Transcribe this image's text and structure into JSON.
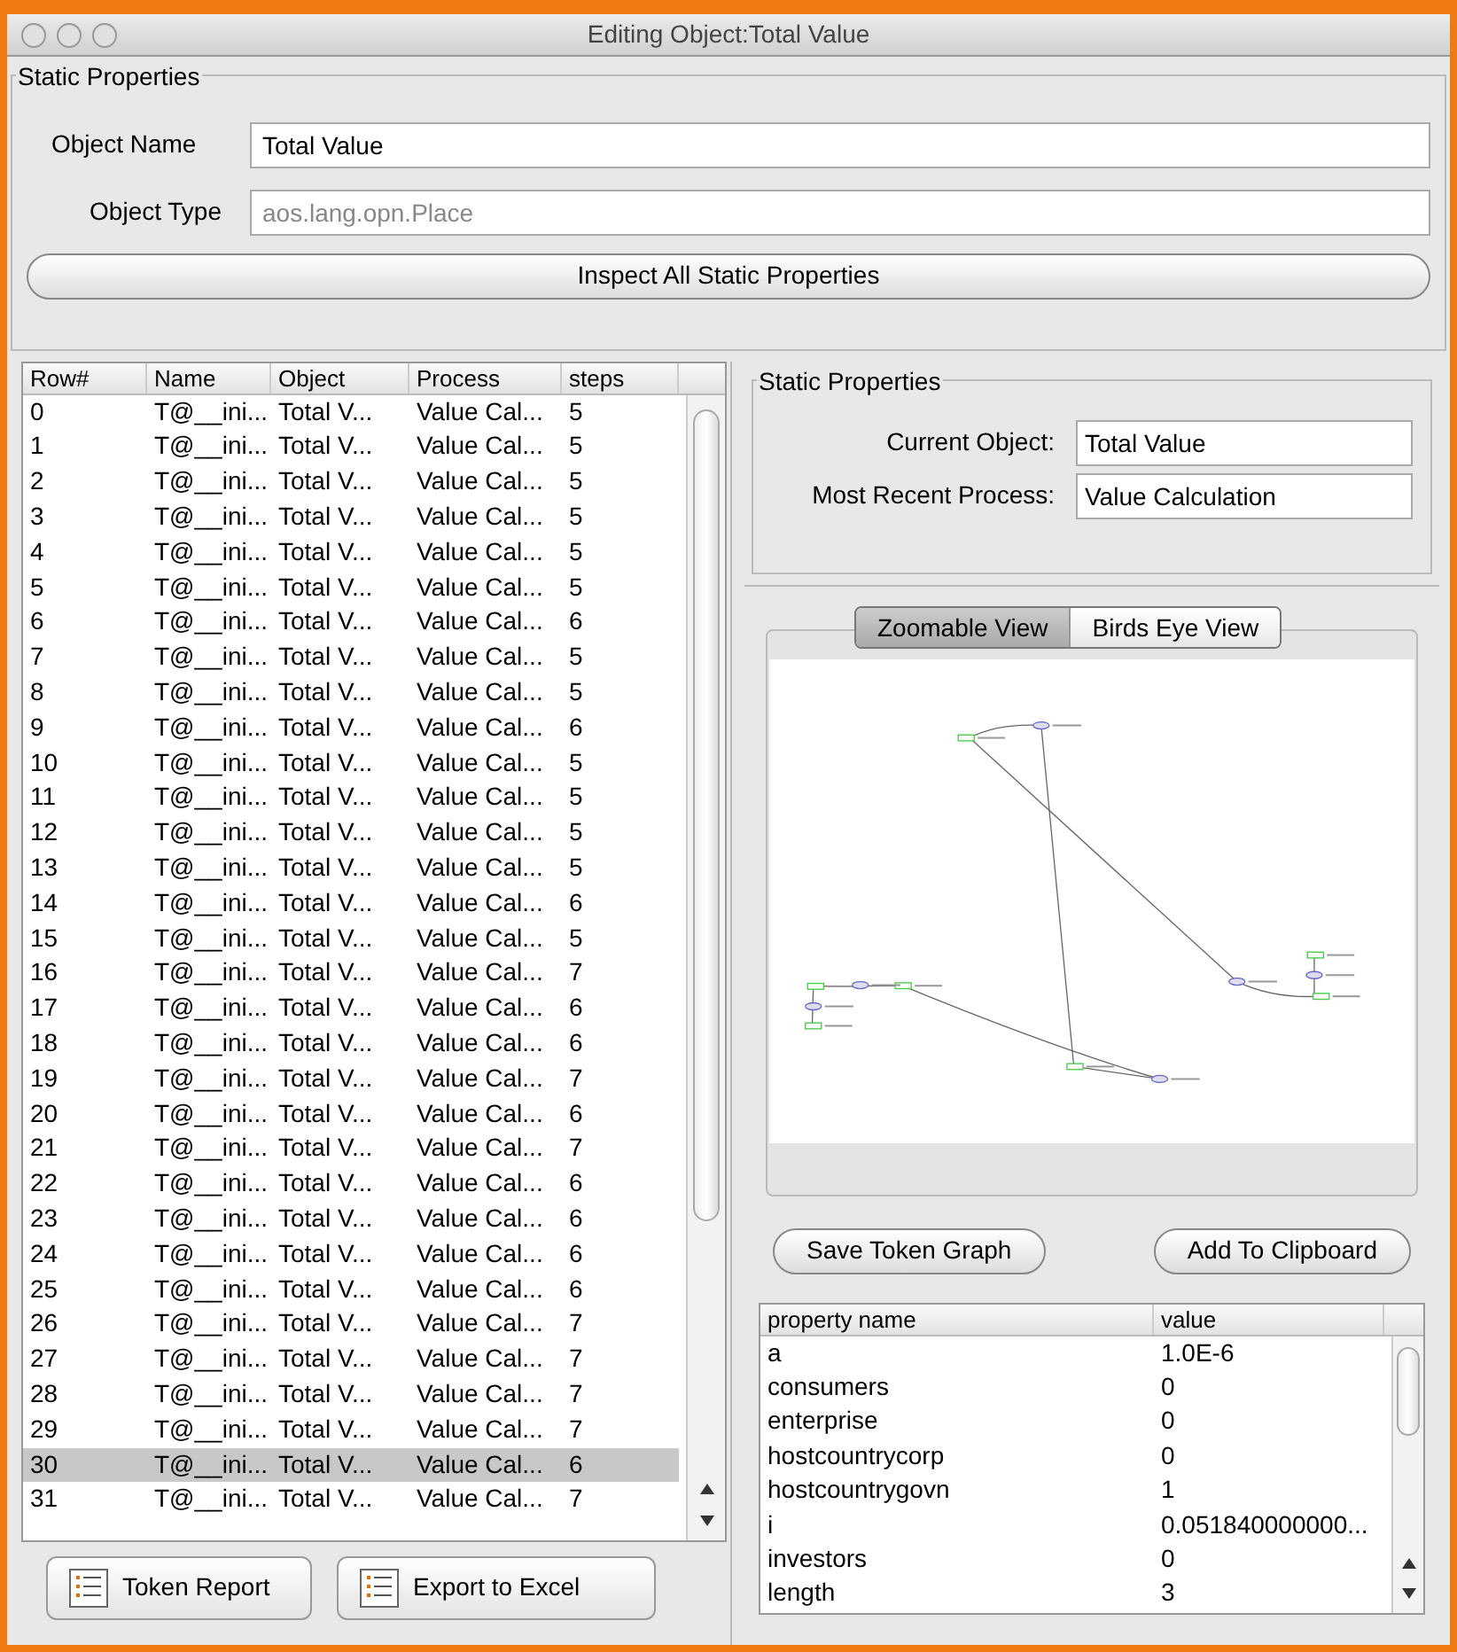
{
  "window": {
    "title": "Editing Object:Total Value"
  },
  "static_properties": {
    "title": "Static Properties",
    "object_name": {
      "label": "Object Name",
      "value": "Total Value"
    },
    "object_type": {
      "label": "Object Type",
      "value": "aos.lang.opn.Place",
      "disabled": true
    },
    "inspect_button": "Inspect All Static Properties"
  },
  "token_table": {
    "columns": [
      "Row#",
      "Name",
      "Object",
      "Process",
      "steps"
    ],
    "rows": [
      {
        "cells": [
          "0",
          "T@__ini...",
          "Total V...",
          "Value Cal...",
          "5"
        ],
        "selected": false
      },
      {
        "cells": [
          "1",
          "T@__ini...",
          "Total V...",
          "Value Cal...",
          "5"
        ],
        "selected": false
      },
      {
        "cells": [
          "2",
          "T@__ini...",
          "Total V...",
          "Value Cal...",
          "5"
        ],
        "selected": false
      },
      {
        "cells": [
          "3",
          "T@__ini...",
          "Total V...",
          "Value Cal...",
          "5"
        ],
        "selected": false
      },
      {
        "cells": [
          "4",
          "T@__ini...",
          "Total V...",
          "Value Cal...",
          "5"
        ],
        "selected": false
      },
      {
        "cells": [
          "5",
          "T@__ini...",
          "Total V...",
          "Value Cal...",
          "5"
        ],
        "selected": false
      },
      {
        "cells": [
          "6",
          "T@__ini...",
          "Total V...",
          "Value Cal...",
          "6"
        ],
        "selected": false
      },
      {
        "cells": [
          "7",
          "T@__ini...",
          "Total V...",
          "Value Cal...",
          "5"
        ],
        "selected": false
      },
      {
        "cells": [
          "8",
          "T@__ini...",
          "Total V...",
          "Value Cal...",
          "5"
        ],
        "selected": false
      },
      {
        "cells": [
          "9",
          "T@__ini...",
          "Total V...",
          "Value Cal...",
          "6"
        ],
        "selected": false
      },
      {
        "cells": [
          "10",
          "T@__ini...",
          "Total V...",
          "Value Cal...",
          "5"
        ],
        "selected": false
      },
      {
        "cells": [
          "11",
          "T@__ini...",
          "Total V...",
          "Value Cal...",
          "5"
        ],
        "selected": false
      },
      {
        "cells": [
          "12",
          "T@__ini...",
          "Total V...",
          "Value Cal...",
          "5"
        ],
        "selected": false
      },
      {
        "cells": [
          "13",
          "T@__ini...",
          "Total V...",
          "Value Cal...",
          "5"
        ],
        "selected": false
      },
      {
        "cells": [
          "14",
          "T@__ini...",
          "Total V...",
          "Value Cal...",
          "6"
        ],
        "selected": false
      },
      {
        "cells": [
          "15",
          "T@__ini...",
          "Total V...",
          "Value Cal...",
          "5"
        ],
        "selected": false
      },
      {
        "cells": [
          "16",
          "T@__ini...",
          "Total V...",
          "Value Cal...",
          "7"
        ],
        "selected": false
      },
      {
        "cells": [
          "17",
          "T@__ini...",
          "Total V...",
          "Value Cal...",
          "6"
        ],
        "selected": false
      },
      {
        "cells": [
          "18",
          "T@__ini...",
          "Total V...",
          "Value Cal...",
          "6"
        ],
        "selected": false
      },
      {
        "cells": [
          "19",
          "T@__ini...",
          "Total V...",
          "Value Cal...",
          "7"
        ],
        "selected": false
      },
      {
        "cells": [
          "20",
          "T@__ini...",
          "Total V...",
          "Value Cal...",
          "6"
        ],
        "selected": false
      },
      {
        "cells": [
          "21",
          "T@__ini...",
          "Total V...",
          "Value Cal...",
          "7"
        ],
        "selected": false
      },
      {
        "cells": [
          "22",
          "T@__ini...",
          "Total V...",
          "Value Cal...",
          "6"
        ],
        "selected": false
      },
      {
        "cells": [
          "23",
          "T@__ini...",
          "Total V...",
          "Value Cal...",
          "6"
        ],
        "selected": false
      },
      {
        "cells": [
          "24",
          "T@__ini...",
          "Total V...",
          "Value Cal...",
          "6"
        ],
        "selected": false
      },
      {
        "cells": [
          "25",
          "T@__ini...",
          "Total V...",
          "Value Cal...",
          "6"
        ],
        "selected": false
      },
      {
        "cells": [
          "26",
          "T@__ini...",
          "Total V...",
          "Value Cal...",
          "7"
        ],
        "selected": false
      },
      {
        "cells": [
          "27",
          "T@__ini...",
          "Total V...",
          "Value Cal...",
          "7"
        ],
        "selected": false
      },
      {
        "cells": [
          "28",
          "T@__ini...",
          "Total V...",
          "Value Cal...",
          "7"
        ],
        "selected": false
      },
      {
        "cells": [
          "29",
          "T@__ini...",
          "Total V...",
          "Value Cal...",
          "7"
        ],
        "selected": false
      },
      {
        "cells": [
          "30",
          "T@__ini...",
          "Total V...",
          "Value Cal...",
          "6"
        ],
        "selected": true
      },
      {
        "cells": [
          "31",
          "T@__ini...",
          "Total V...",
          "Value Cal...",
          "7"
        ],
        "selected": false
      }
    ]
  },
  "left_buttons": [
    "Token Report",
    "Export to Excel"
  ],
  "current_info": {
    "title": "Static Properties",
    "current_object": {
      "label": "Current Object:",
      "value": "Total Value"
    },
    "most_recent_process": {
      "label": "Most Recent Process:",
      "value": "Value Calculation"
    }
  },
  "graph_tabs": [
    {
      "label": "Zoomable View",
      "selected": true
    },
    {
      "label": "Birds Eye View",
      "selected": false
    }
  ],
  "graph_buttons": [
    "Save Token Graph",
    "Add To Clipboard"
  ],
  "property_table": {
    "columns": [
      "property name",
      "value"
    ],
    "rows": [
      [
        "a",
        "1.0E-6"
      ],
      [
        "consumers",
        "0"
      ],
      [
        "enterprise",
        "0"
      ],
      [
        "hostcountrycorp",
        "0"
      ],
      [
        "hostcountrygovn",
        "1"
      ],
      [
        "i",
        "0.051840000000..."
      ],
      [
        "investors",
        "0"
      ],
      [
        "length",
        "3"
      ]
    ]
  }
}
